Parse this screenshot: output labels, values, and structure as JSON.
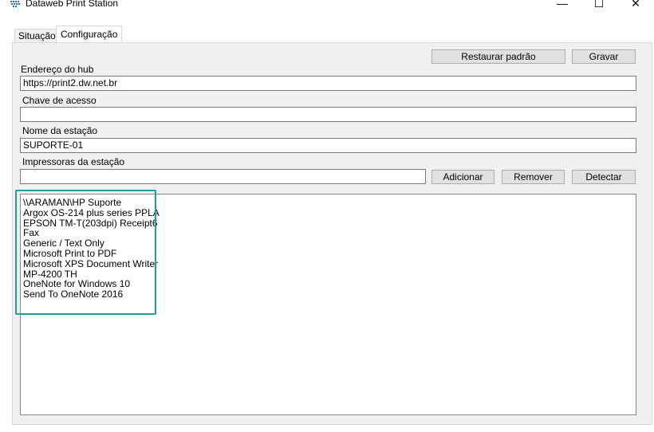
{
  "window": {
    "title": "Dataweb Print Station",
    "icon": "dataweb-logo-icon",
    "minimize_glyph": "—",
    "maximize_glyph": "☐",
    "close_glyph": "✕"
  },
  "tabs": [
    {
      "label": "Situação",
      "active": false
    },
    {
      "label": "Configuração",
      "active": true
    }
  ],
  "toolbar": {
    "restore_label": "Restaurar padrão",
    "save_label": "Gravar"
  },
  "form": {
    "hub_label": "Endereço do hub",
    "hub_value": "https://print2.dw.net.br",
    "key_label": "Chave de acesso",
    "key_value": "",
    "station_label": "Nome da estação",
    "station_value": "SUPORTE-01",
    "printers_label": "Impressoras da estação",
    "printer_input_value": "",
    "add_label": "Adicionar",
    "remove_label": "Remover",
    "detect_label": "Detectar"
  },
  "printers": [
    "\\\\ARAMAN\\HP Suporte",
    "Argox OS-214 plus series PPLA",
    "EPSON TM-T(203dpi) Receipt6",
    "Fax",
    "Generic / Text Only",
    "Microsoft Print to PDF",
    "Microsoft XPS Document Writer",
    "MP-4200 TH",
    "OneNote for Windows 10",
    "Send To OneNote 2016"
  ],
  "colors": {
    "highlight": "#1aa39a",
    "panel_bg": "#f0f0f0",
    "button_bg": "#e1e1e1"
  }
}
